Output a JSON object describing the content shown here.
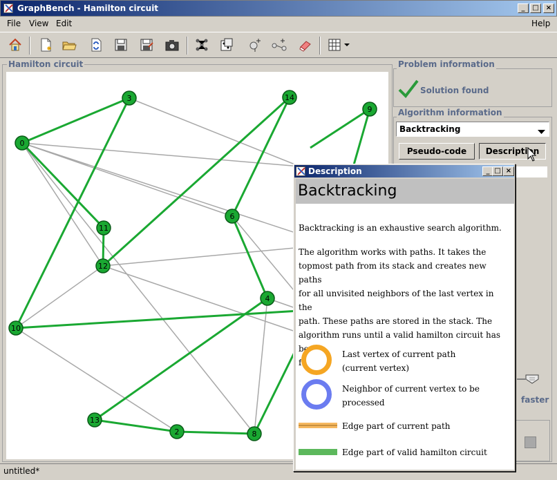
{
  "window": {
    "title": "GraphBench - Hamilton circuit"
  },
  "menu": {
    "file": "File",
    "view": "View",
    "edit": "Edit",
    "help": "Help"
  },
  "toolbar": {
    "icons": [
      "home-icon",
      "new-file-icon",
      "open-folder-icon",
      "refresh-icon",
      "save-icon",
      "save-as-icon",
      "camera-icon",
      "graph-layout-icon",
      "random-graph-icon",
      "add-vertex-icon",
      "add-edge-icon",
      "eraser-icon",
      "grid-icon"
    ]
  },
  "hamilton_panel": {
    "label": "Hamilton circuit"
  },
  "problem_panel": {
    "label": "Problem information",
    "status": "Solution found"
  },
  "algorithm_panel": {
    "label": "Algorithm information",
    "selected": "Backtracking",
    "pseudo_code_button": "Pseudo-code",
    "description_button": "Description",
    "speed_label": "faster"
  },
  "graph": {
    "nodes": [
      {
        "id": "0"
      },
      {
        "id": "3"
      },
      {
        "id": "14"
      },
      {
        "id": "9"
      },
      {
        "id": "11"
      },
      {
        "id": "6"
      },
      {
        "id": "12"
      },
      {
        "id": "4"
      },
      {
        "id": "10"
      },
      {
        "id": "13"
      },
      {
        "id": "2"
      },
      {
        "id": "8"
      }
    ],
    "colors": {
      "node_fill": "#1aa832",
      "circuit_edge": "#1aa832",
      "other_edge": "#a8a8a8"
    }
  },
  "status": {
    "text": "untitled*"
  },
  "dialog": {
    "title": "Description",
    "heading": "Backtracking",
    "para1": "Backtracking is an exhaustive search algorithm.",
    "para2_lines": [
      "The algorithm works with paths. It takes the",
      "topmost path from its stack and creates new paths",
      "for all unvisited neighbors of the last vertex in the",
      "path.  These paths are stored in the stack.  The",
      "algorithm runs until a valid hamilton circuit has been",
      "found."
    ],
    "legend": {
      "current_vertex_line1": "Last vertex of current path",
      "current_vertex_line2": "(current vertex)",
      "neighbor_line1": "Neighbor of current vertex to be",
      "neighbor_line2": "processed",
      "current_edge": "Edge part of current path",
      "circuit_edge": "Edge part of valid hamilton circuit"
    },
    "colors": {
      "current": "#f5a623",
      "neighbor": "#6b7cf0",
      "circuit": "#5cb85c"
    }
  }
}
